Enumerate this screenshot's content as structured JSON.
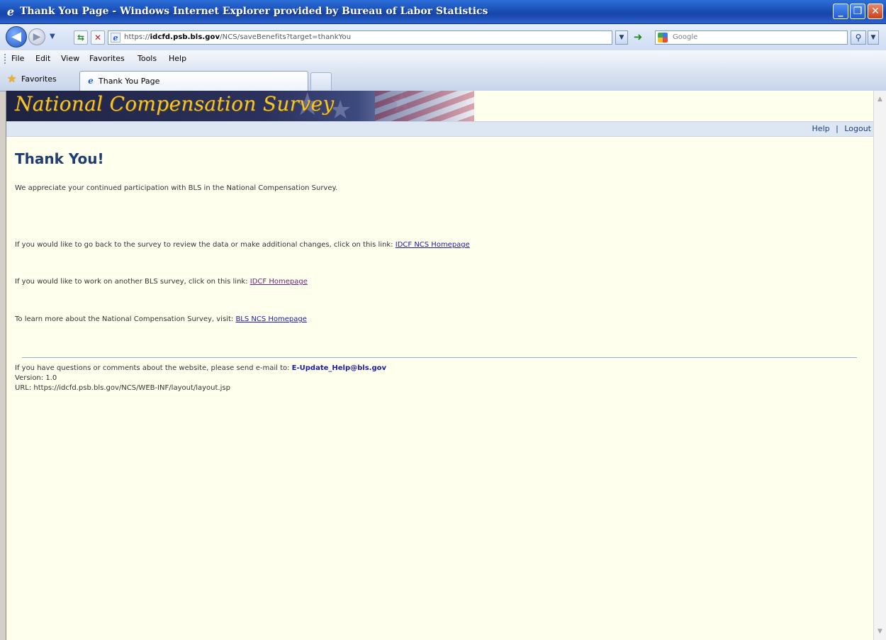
{
  "window": {
    "title": "Thank You Page - Windows Internet Explorer provided by Bureau of Labor Statistics",
    "minimize": "_",
    "maximize": "❐",
    "close": "✕"
  },
  "address_bar": {
    "url_prefix": "https://",
    "url_domain": "idcfd.psb.bls.gov",
    "url_path": "/NCS/saveBenefits?target=thankYou",
    "search_placeholder": "Google"
  },
  "menu": {
    "items": [
      "File",
      "Edit",
      "View",
      "Favorites",
      "Tools",
      "Help"
    ]
  },
  "tabs": {
    "favorites_label": "Favorites",
    "active_tab": "Thank You Page"
  },
  "page": {
    "banner_title": "National Compensation Survey",
    "help_link": "Help",
    "separator": "|",
    "logout_link": "Logout",
    "heading": "Thank You!",
    "intro": "We appreciate your continued participation with BLS in the National Compensation Survey.",
    "review_text": "If you would like to go back to the survey to review the data or make additional changes, click on this link:",
    "review_link": "IDCF NCS Homepage",
    "another_text": "If you would like to work on another BLS survey, click on this link:",
    "another_link": "IDCF Homepage",
    "learn_text": "To learn more about the National Compensation Survey, visit:",
    "learn_link": "BLS NCS Homepage",
    "footer_text": "If you have questions or comments about the website, please send e-mail to:",
    "footer_email": "E-Update_Help@bls.gov",
    "version": "Version: 1.0",
    "url_line": "URL: https://idcfd.psb.bls.gov/NCS/WEB-INF/layout/layout.jsp"
  },
  "colors": {
    "page_background": "#ffffee",
    "heading": "#1f3d6e",
    "link": "#1a1aa8",
    "visited_link": "#6d1c7c",
    "banner_title": "#f2c632"
  }
}
